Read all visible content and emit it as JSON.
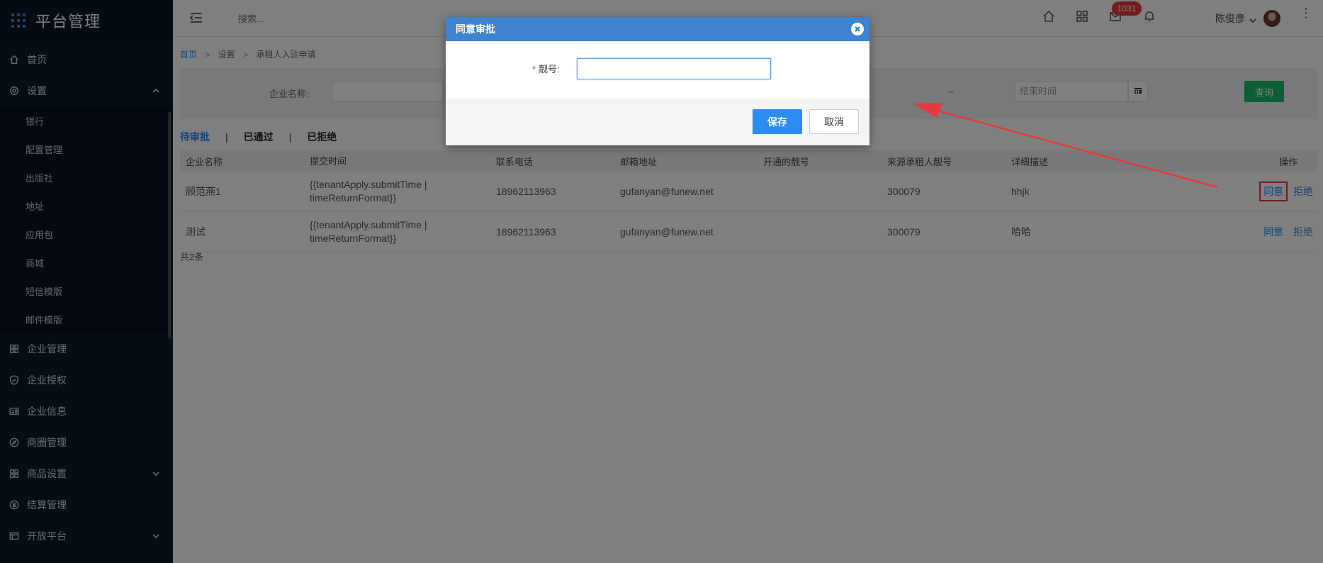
{
  "sidebar": {
    "brand": "平台管理",
    "items": [
      {
        "label": "首页",
        "icon": "home-icon"
      },
      {
        "label": "设置",
        "icon": "gear-icon",
        "expanded": true
      },
      {
        "label": "企业管理",
        "icon": "building-icon"
      },
      {
        "label": "企业授权",
        "icon": "shield-icon"
      },
      {
        "label": "企业信息",
        "icon": "idcard-icon"
      },
      {
        "label": "商圈管理",
        "icon": "compass-icon"
      },
      {
        "label": "商品设置",
        "icon": "grid-icon",
        "has_children": true
      },
      {
        "label": "结算管理",
        "icon": "yen-icon"
      },
      {
        "label": "开放平台",
        "icon": "panel-icon",
        "has_children": true
      }
    ],
    "submenu": [
      "银行",
      "配置管理",
      "出版社",
      "地址",
      "应用包",
      "商城",
      "短信模版",
      "邮件模版"
    ]
  },
  "topbar": {
    "search_placeholder": "搜索...",
    "badge_count": "1031",
    "user_name": "陈俊彦"
  },
  "breadcrumb": {
    "home": "首页",
    "settings": "设置",
    "current": "承租人入驻申请",
    "separator": ">"
  },
  "filter": {
    "company_label": "企业名称:",
    "range_sep": "~",
    "end_time_placeholder": "结束时间",
    "query_label": "查询"
  },
  "status_tabs": {
    "pending": "待审批",
    "approved": "已通过",
    "rejected": "已拒绝",
    "divider": "|"
  },
  "table": {
    "headers": [
      "企业名称",
      "提交时间",
      "联系电话",
      "邮箱地址",
      "开通的靓号",
      "来源承租人靓号",
      "详细描述",
      "操作"
    ],
    "rows": [
      {
        "company": "顾范燕1",
        "submit_time": "{{tenantApply.submitTime | timeReturnFormat}}",
        "phone": "18962113963",
        "email": "gufanyan@funew.net",
        "number": "",
        "source": "300079",
        "desc": "hhjk",
        "approve": "同意",
        "reject": "拒绝"
      },
      {
        "company": "测试",
        "submit_time": "{{tenantApply.submitTime | timeReturnFormat}}",
        "phone": "18962113963",
        "email": "gufanyan@funew.net",
        "number": "",
        "source": "300079",
        "desc": "哈哈",
        "approve": "同意",
        "reject": "拒绝"
      }
    ],
    "total": "共2条"
  },
  "modal": {
    "title": "同意审批",
    "required_mark": "*",
    "field_label": "靓号:",
    "field_value": "",
    "save_label": "保存",
    "cancel_label": "取消"
  },
  "colors": {
    "sidebar_bg": "#0b1a2b",
    "accent": "#2d8cf0",
    "query_green": "#19be6b",
    "modal_header": "#3d83cf",
    "badge_red": "#e4393c",
    "annotation_red": "#e4393c"
  }
}
